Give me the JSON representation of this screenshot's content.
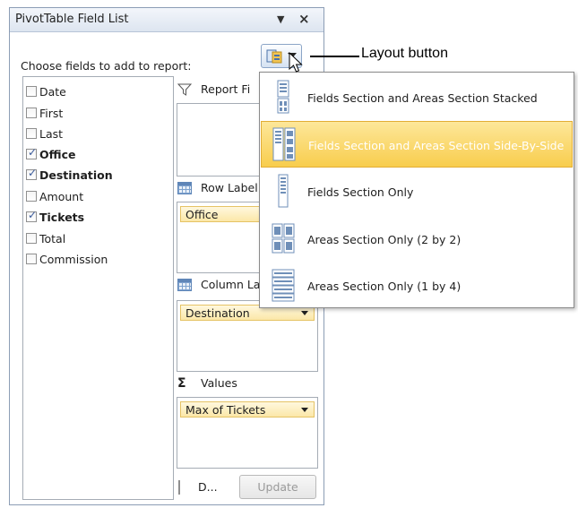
{
  "pane": {
    "title": "PivotTable Field List",
    "menu_icon": "dropdown-arrow",
    "close_icon": "close",
    "choose_label": "Choose fields to add to report:"
  },
  "fields": [
    {
      "label": "Date",
      "checked": false,
      "bold": false
    },
    {
      "label": "First",
      "checked": false,
      "bold": false
    },
    {
      "label": "Last",
      "checked": false,
      "bold": false
    },
    {
      "label": "Office",
      "checked": true,
      "bold": true
    },
    {
      "label": "Destination",
      "checked": true,
      "bold": true
    },
    {
      "label": "Amount",
      "checked": false,
      "bold": false
    },
    {
      "label": "Tickets",
      "checked": true,
      "bold": true
    },
    {
      "label": "Total",
      "checked": false,
      "bold": false
    },
    {
      "label": "Commission",
      "checked": false,
      "bold": false
    }
  ],
  "areas": {
    "report_filter": {
      "label": "Report Fi"
    },
    "row_labels": {
      "label": "Row Label",
      "items": [
        "Office"
      ]
    },
    "column_labels": {
      "label": "Column La",
      "items": [
        "Destination"
      ]
    },
    "values": {
      "label": "Values",
      "icon": "sigma",
      "items": [
        "Max of Tickets"
      ]
    }
  },
  "bottom": {
    "defer_label": "D...",
    "update_label": "Update"
  },
  "layout_menu": {
    "items": [
      {
        "label": "Fields Section and Areas Section Stacked",
        "icon": "stacked-layout",
        "selected": false
      },
      {
        "label": "Fields Section and Areas Section Side-By-Side",
        "icon": "side-by-side-layout",
        "selected": true
      },
      {
        "label": "Fields Section Only",
        "icon": "fields-only-layout",
        "selected": false
      },
      {
        "label": "Areas Section Only (2 by 2)",
        "icon": "areas-2x2-layout",
        "selected": false
      },
      {
        "label": "Areas Section Only (1 by 4)",
        "icon": "areas-1x4-layout",
        "selected": false
      }
    ]
  },
  "callout": {
    "label": "Layout button"
  },
  "colors": {
    "selected_highlight": "#f8cd4d",
    "pill_fill": "#fbe7a8",
    "border": "#8c9db5"
  }
}
